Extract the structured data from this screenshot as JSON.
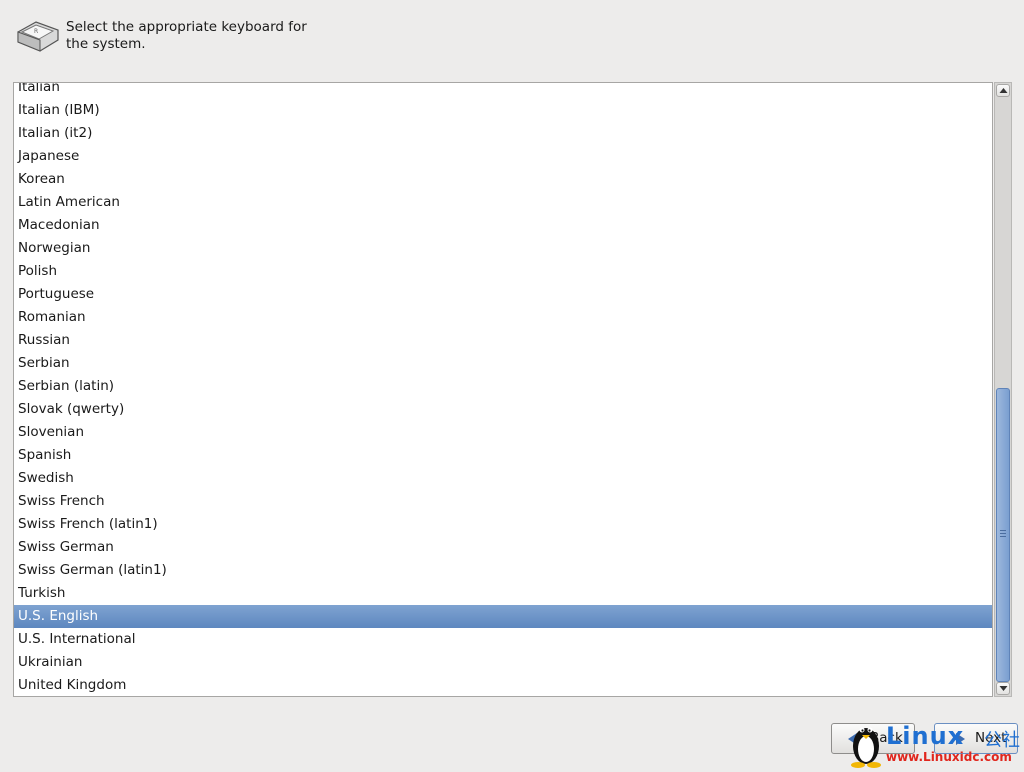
{
  "header": {
    "icon": "keyboard-key-icon",
    "prompt": "Select the appropriate keyboard for the system."
  },
  "keyboard_list": {
    "items": [
      "Italian",
      "Italian (IBM)",
      "Italian (it2)",
      "Japanese",
      "Korean",
      "Latin American",
      "Macedonian",
      "Norwegian",
      "Polish",
      "Portuguese",
      "Romanian",
      "Russian",
      "Serbian",
      "Serbian (latin)",
      "Slovak (qwerty)",
      "Slovenian",
      "Spanish",
      "Swedish",
      "Swiss French",
      "Swiss French (latin1)",
      "Swiss German",
      "Swiss German (latin1)",
      "Turkish",
      "U.S. English",
      "U.S. International",
      "Ukrainian",
      "United Kingdom"
    ],
    "selected": "U.S. English",
    "selection_color": "#6a91c6"
  },
  "buttons": {
    "back_label": "Back",
    "next_label": "Next"
  },
  "watermark": {
    "brand": "Linux",
    "brand_cn": "公社",
    "url": "www.Linuxidc.com"
  }
}
